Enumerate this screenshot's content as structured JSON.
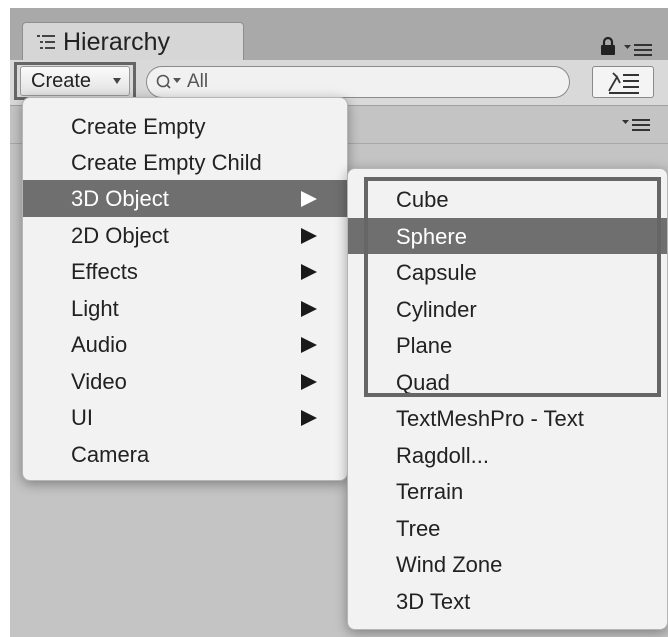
{
  "window": {
    "tab_title": "Hierarchy"
  },
  "toolbar": {
    "create_label": "Create",
    "search_placeholder": "All"
  },
  "create_menu": {
    "items": [
      {
        "label": "Create Empty",
        "submenu": false
      },
      {
        "label": "Create Empty Child",
        "submenu": false
      },
      {
        "label": "3D Object",
        "submenu": true,
        "selected": true
      },
      {
        "label": "2D Object",
        "submenu": true
      },
      {
        "label": "Effects",
        "submenu": true
      },
      {
        "label": "Light",
        "submenu": true
      },
      {
        "label": "Audio",
        "submenu": true
      },
      {
        "label": "Video",
        "submenu": true
      },
      {
        "label": "UI",
        "submenu": true
      },
      {
        "label": "Camera",
        "submenu": false
      }
    ]
  },
  "submenu_3d": {
    "items": [
      {
        "label": "Cube"
      },
      {
        "label": "Sphere",
        "selected": true
      },
      {
        "label": "Capsule"
      },
      {
        "label": "Cylinder"
      },
      {
        "label": "Plane"
      },
      {
        "label": "Quad"
      },
      {
        "label": "TextMeshPro - Text"
      },
      {
        "label": "Ragdoll..."
      },
      {
        "label": "Terrain"
      },
      {
        "label": "Tree"
      },
      {
        "label": "Wind Zone"
      },
      {
        "label": "3D Text"
      }
    ]
  },
  "colors": {
    "selection": "#6f6f6f",
    "menu_background": "#f2f2f2",
    "panel_background": "#c4c4c4",
    "highlight_border": "#666666"
  }
}
